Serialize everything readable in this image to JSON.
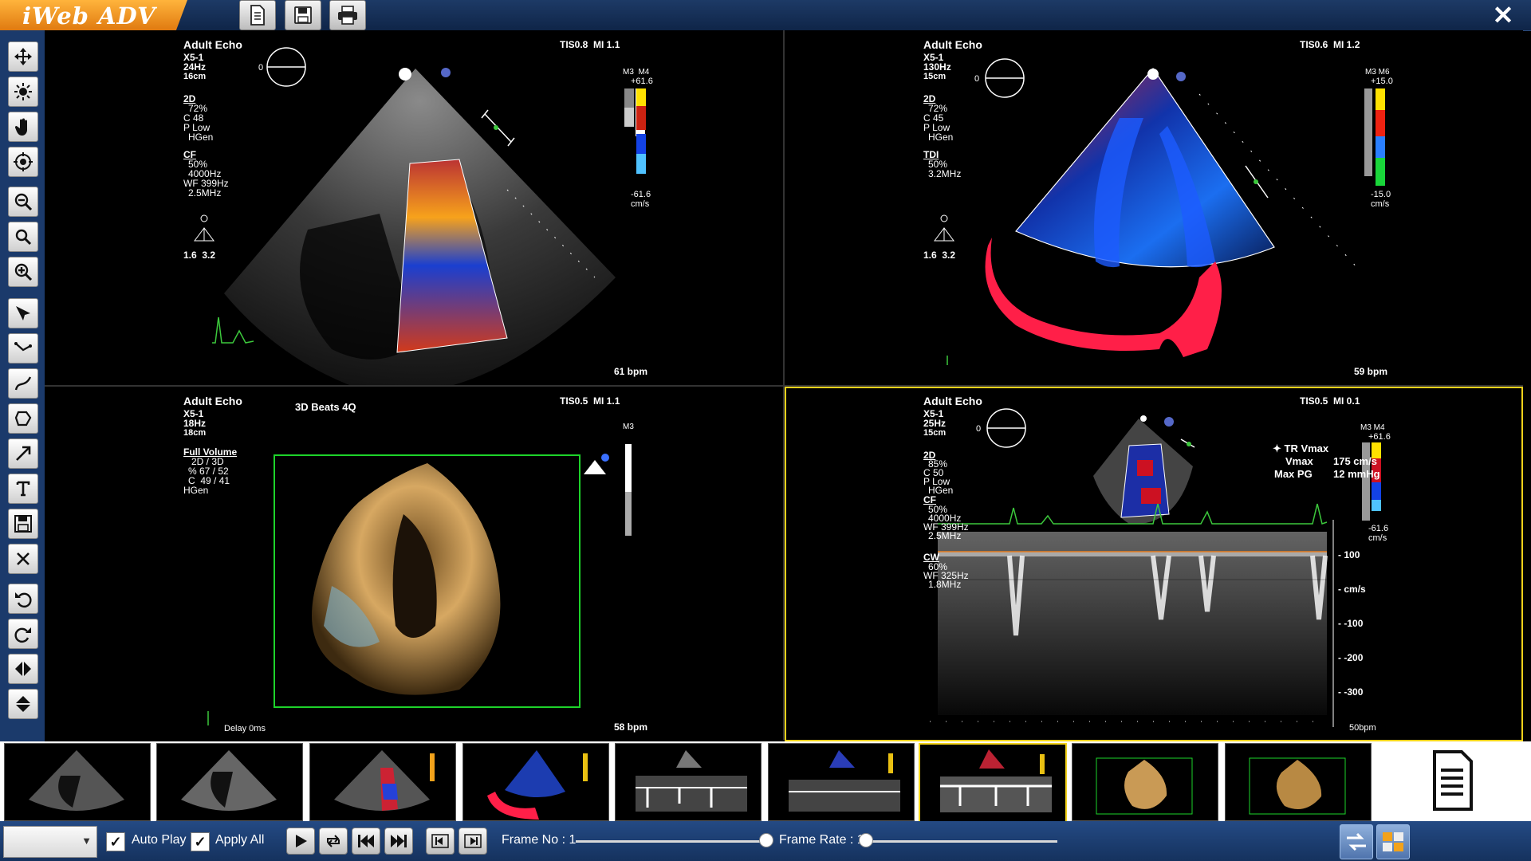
{
  "app": {
    "title": "iWeb ADV"
  },
  "panels": [
    {
      "exam": "Adult Echo",
      "probe": "X5-1",
      "fps": "24Hz",
      "depth": "16cm",
      "tis_mi": "TIS0.8  MI 1.1",
      "mode1": "2D",
      "mode1_params": [
        "72%",
        "C 48",
        "P Low",
        "HGen"
      ],
      "mode2": "CF",
      "mode2_params": [
        "50%",
        "4000Hz",
        "WF 399Hz",
        "2.5MHz"
      ],
      "orient_marker": "0",
      "depth_vals": "1.6  3.2",
      "scale_top_label": "M3  M4",
      "scale_max": "+61.6",
      "scale_min": "-61.6",
      "scale_unit": "cm/s",
      "bpm": "61 bpm"
    },
    {
      "exam": "Adult Echo",
      "probe": "X5-1",
      "fps": "130Hz",
      "depth": "15cm",
      "tis_mi": "TIS0.6  MI 1.2",
      "mode1": "2D",
      "mode1_params": [
        "72%",
        "C 45",
        "P Low",
        "HGen"
      ],
      "mode2": "TDI",
      "mode2_params": [
        "50%",
        "3.2MHz"
      ],
      "orient_marker": "0",
      "depth_vals": "1.6  3.2",
      "scale_top_label": "M3 M6",
      "scale_max": "+15.0",
      "scale_min": "-15.0",
      "scale_unit": "cm/s",
      "bpm": "59 bpm"
    },
    {
      "exam": "Adult Echo",
      "probe": "X5-1",
      "fps": "18Hz",
      "depth": "18cm",
      "tis_mi": "TIS0.5  MI 1.1",
      "view_title": "3D Beats 4Q",
      "mode1": "Full Volume",
      "mode1_params": [
        "2D / 3D",
        "% 67 / 52",
        "C  49 / 41",
        "HGen"
      ],
      "scale_top_label": "M3",
      "delay": "Delay 0ms",
      "bpm": "58 bpm"
    },
    {
      "exam": "Adult Echo",
      "probe": "X5-1",
      "fps": "25Hz",
      "depth": "15cm",
      "tis_mi": "TIS0.5  MI 0.1",
      "mode1": "2D",
      "mode1_params": [
        "85%",
        "C 50",
        "P Low",
        "HGen"
      ],
      "mode2": "CF",
      "mode2_params": [
        "50%",
        "4000Hz",
        "WF 399Hz",
        "2.5MHz"
      ],
      "mode3": "CW",
      "mode3_params": [
        "60%",
        "WF 325Hz",
        "1.8MHz"
      ],
      "orient_marker": "0",
      "scale_top_label": "M3 M4",
      "scale_max": "+61.6",
      "scale_min": "-61.6",
      "scale_unit": "cm/s",
      "measure_title": "TR Vmax",
      "measure_vmax_label": "Vmax",
      "measure_vmax_value": "175 cm/s",
      "measure_pg_label": "Max PG",
      "measure_pg_value": "12 mmHg",
      "doppler_ticks": [
        "100",
        "cm/s",
        "-100",
        "-200",
        "-300"
      ],
      "bpm": "50bpm"
    }
  ],
  "bottom": {
    "auto_play": "Auto Play",
    "apply_all": "Apply All",
    "frame_no": "Frame No : 1",
    "frame_rate": "Frame Rate : 1"
  },
  "colors": {
    "accent_yellow": "#f2d21a",
    "toolbar_blue": "#1b3a6b",
    "trace_green": "#3cc83c",
    "logo_orange": "#f39a1e"
  }
}
